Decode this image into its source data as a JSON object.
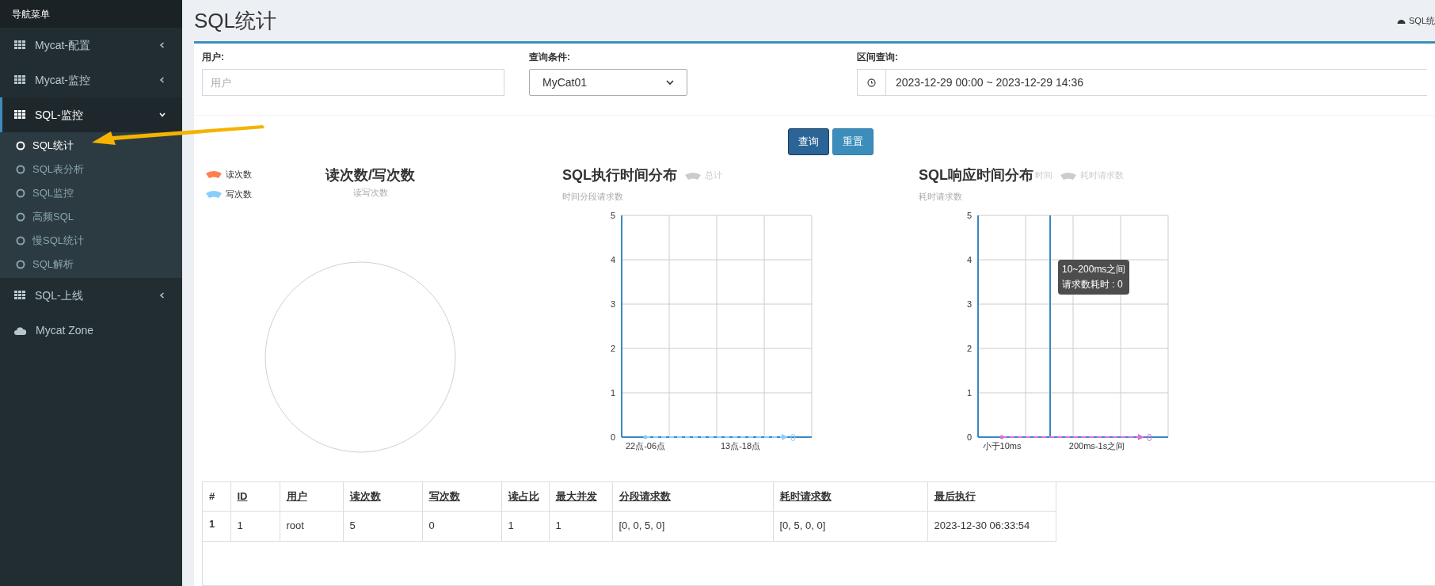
{
  "sidebar": {
    "header": "导航菜单",
    "items": [
      {
        "label": "Mycat-配置",
        "kind": "group",
        "expanded": false,
        "selected": false
      },
      {
        "label": "Mycat-监控",
        "kind": "group",
        "expanded": false,
        "selected": false
      },
      {
        "label": "SQL-监控",
        "kind": "group",
        "expanded": true,
        "selected": true,
        "children": [
          {
            "label": "SQL统计",
            "selected": true
          },
          {
            "label": "SQL表分析",
            "selected": false
          },
          {
            "label": "SQL监控",
            "selected": false
          },
          {
            "label": "高频SQL",
            "selected": false
          },
          {
            "label": "慢SQL统计",
            "selected": false
          },
          {
            "label": "SQL解析",
            "selected": false
          }
        ]
      },
      {
        "label": "SQL-上线",
        "kind": "group",
        "expanded": false,
        "selected": false
      },
      {
        "label": "Mycat Zone",
        "kind": "link",
        "selected": false
      }
    ]
  },
  "page": {
    "title": "SQL统计",
    "breadcrumb": "SQL统"
  },
  "form": {
    "user": {
      "label": "用户:",
      "placeholder": "用户"
    },
    "condition": {
      "label": "查询条件:",
      "value": "MyCat01"
    },
    "range": {
      "label": "区间查询:",
      "value": "2023-12-29 00:00 ~ 2023-12-29 14:36"
    }
  },
  "buttons": [
    {
      "label": "查询",
      "kind": "primary"
    },
    {
      "label": "重置",
      "kind": "info"
    }
  ],
  "charts": [
    {
      "kind": "pie",
      "title": "读次数/写次数",
      "subtitle": "读写次数",
      "legend": [
        {
          "label": "读次数",
          "color": "#ff7f50"
        },
        {
          "label": "写次数",
          "color": "#87cefa"
        }
      ]
    },
    {
      "kind": "plot",
      "title": "SQL执行时间分布",
      "subtitle": "时间分段请求数",
      "legend": [
        {
          "label": "总计",
          "kind": "swatch",
          "enabled": false
        }
      ],
      "end_label": "0",
      "chart_data": {
        "type": "line",
        "categories": [
          "22点-06点",
          null,
          "13点-18点",
          null
        ],
        "ylim": [
          0,
          5
        ],
        "yticks": [
          0,
          1,
          2,
          3,
          4,
          5
        ],
        "grid": true,
        "series": [
          {
            "color": "#87cefa",
            "line_style": "dashed",
            "values": [
              0,
              0,
              0,
              0
            ]
          }
        ]
      }
    },
    {
      "kind": "plot",
      "title": "SQL响应时间分布",
      "subtitle": "耗时请求数",
      "legend": [
        {
          "label": "时间",
          "kind": "partial",
          "enabled": false
        },
        {
          "label": "耗时请求数",
          "kind": "swatch",
          "enabled": false
        }
      ],
      "end_label": "0",
      "tooltip": {
        "lines": [
          "10~200ms之间",
          "请求数耗时 : 0"
        ]
      },
      "chart_data": {
        "type": "line",
        "categories": [
          "小于10ms",
          null,
          "200ms-1s之间",
          null
        ],
        "ylim": [
          0,
          5
        ],
        "yticks": [
          0,
          1,
          2,
          3,
          4,
          5
        ],
        "grid": true,
        "series": [
          {
            "color": "#da70d6",
            "line_style": "dashed",
            "values": [
              0,
              0,
              0,
              0
            ]
          }
        ]
      }
    }
  ],
  "table": {
    "columns": [
      "#",
      "ID",
      "用户",
      "读次数",
      "写次数",
      "读占比",
      "最大并发",
      "分段请求数",
      "耗时请求数",
      "最后执行"
    ],
    "rows": [
      [
        "1",
        "1",
        "root",
        "5",
        "0",
        "1",
        "1",
        "[0, 0, 5, 0]",
        "[0, 5, 0, 0]",
        "2023-12-30 06:33:54"
      ]
    ]
  }
}
